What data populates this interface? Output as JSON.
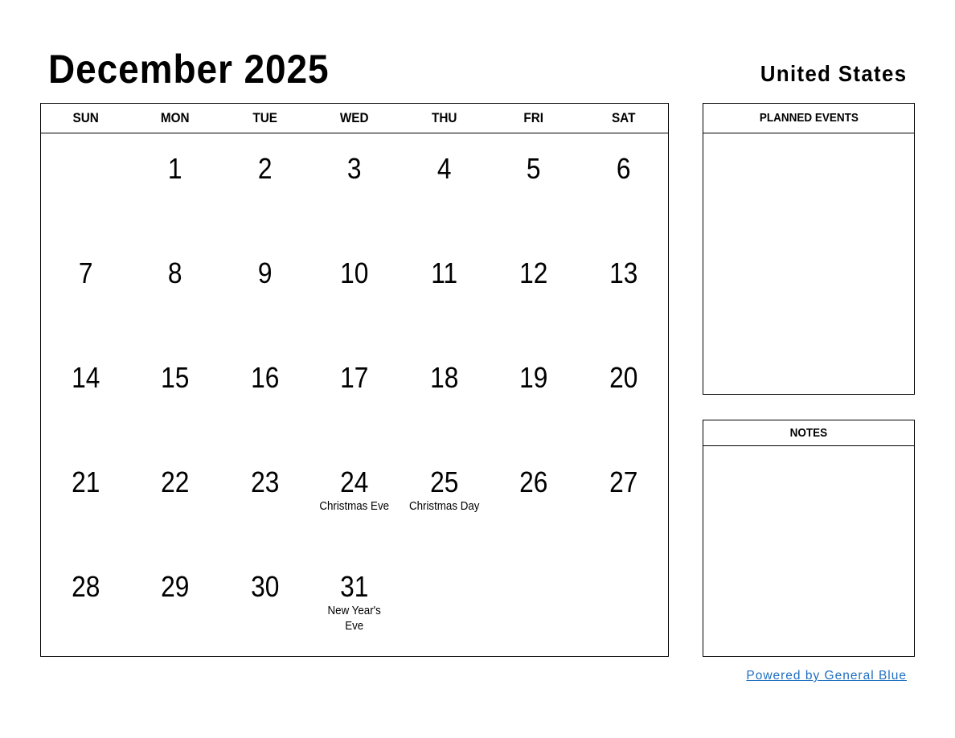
{
  "header": {
    "title": "December 2025",
    "country": "United States"
  },
  "calendar": {
    "weekdays": [
      "SUN",
      "MON",
      "TUE",
      "WED",
      "THU",
      "FRI",
      "SAT"
    ],
    "first_weekday_index": 1,
    "days_in_month": 31,
    "holidays": {
      "24": "Christmas Eve",
      "25": "Christmas Day",
      "31": "New Year's Eve"
    }
  },
  "panels": {
    "planned_events": {
      "title": "PLANNED EVENTS"
    },
    "notes": {
      "title": "NOTES"
    }
  },
  "footer": {
    "link_text": "Powered by General Blue"
  },
  "colors": {
    "text": "#000000",
    "border": "#000000",
    "link": "#1f6fc0"
  }
}
